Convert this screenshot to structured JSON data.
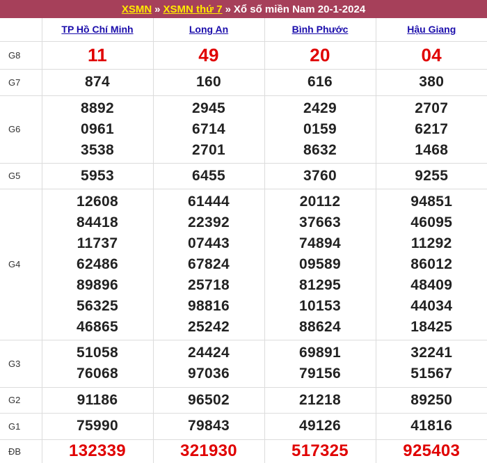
{
  "header": {
    "link1": "XSMN",
    "sep1": "»",
    "link2": "XSMN thứ 7",
    "sep2": "»",
    "title": "Xổ số miền Nam 20-1-2024"
  },
  "provinces": [
    "TP Hồ Chí Minh",
    "Long An",
    "Bình Phước",
    "Hậu Giang"
  ],
  "prizes": [
    {
      "label": "G8",
      "results": [
        [
          "11"
        ],
        [
          "49"
        ],
        [
          "20"
        ],
        [
          "04"
        ]
      ]
    },
    {
      "label": "G7",
      "results": [
        [
          "874"
        ],
        [
          "160"
        ],
        [
          "616"
        ],
        [
          "380"
        ]
      ]
    },
    {
      "label": "G6",
      "results": [
        [
          "8892",
          "0961",
          "3538"
        ],
        [
          "2945",
          "6714",
          "2701"
        ],
        [
          "2429",
          "0159",
          "8632"
        ],
        [
          "2707",
          "6217",
          "1468"
        ]
      ]
    },
    {
      "label": "G5",
      "results": [
        [
          "5953"
        ],
        [
          "6455"
        ],
        [
          "3760"
        ],
        [
          "9255"
        ]
      ]
    },
    {
      "label": "G4",
      "results": [
        [
          "12608",
          "84418",
          "11737",
          "62486",
          "89896",
          "56325",
          "46865"
        ],
        [
          "61444",
          "22392",
          "07443",
          "67824",
          "25718",
          "98816",
          "25242"
        ],
        [
          "20112",
          "37663",
          "74894",
          "09589",
          "81295",
          "10153",
          "88624"
        ],
        [
          "94851",
          "46095",
          "11292",
          "86012",
          "48409",
          "44034",
          "18425"
        ]
      ]
    },
    {
      "label": "G3",
      "results": [
        [
          "51058",
          "76068"
        ],
        [
          "24424",
          "97036"
        ],
        [
          "69891",
          "79156"
        ],
        [
          "32241",
          "51567"
        ]
      ]
    },
    {
      "label": "G2",
      "results": [
        [
          "91186"
        ],
        [
          "96502"
        ],
        [
          "21218"
        ],
        [
          "89250"
        ]
      ]
    },
    {
      "label": "G1",
      "results": [
        [
          "75990"
        ],
        [
          "79843"
        ],
        [
          "49126"
        ],
        [
          "41816"
        ]
      ]
    },
    {
      "label": "ĐB",
      "results": [
        [
          "132339"
        ],
        [
          "321930"
        ],
        [
          "517325"
        ],
        [
          "925403"
        ]
      ]
    }
  ],
  "colors": {
    "header_bg": "#a6405a",
    "header_link": "#ffea00",
    "province_link": "#1a0dab",
    "highlight": "#e00000"
  }
}
